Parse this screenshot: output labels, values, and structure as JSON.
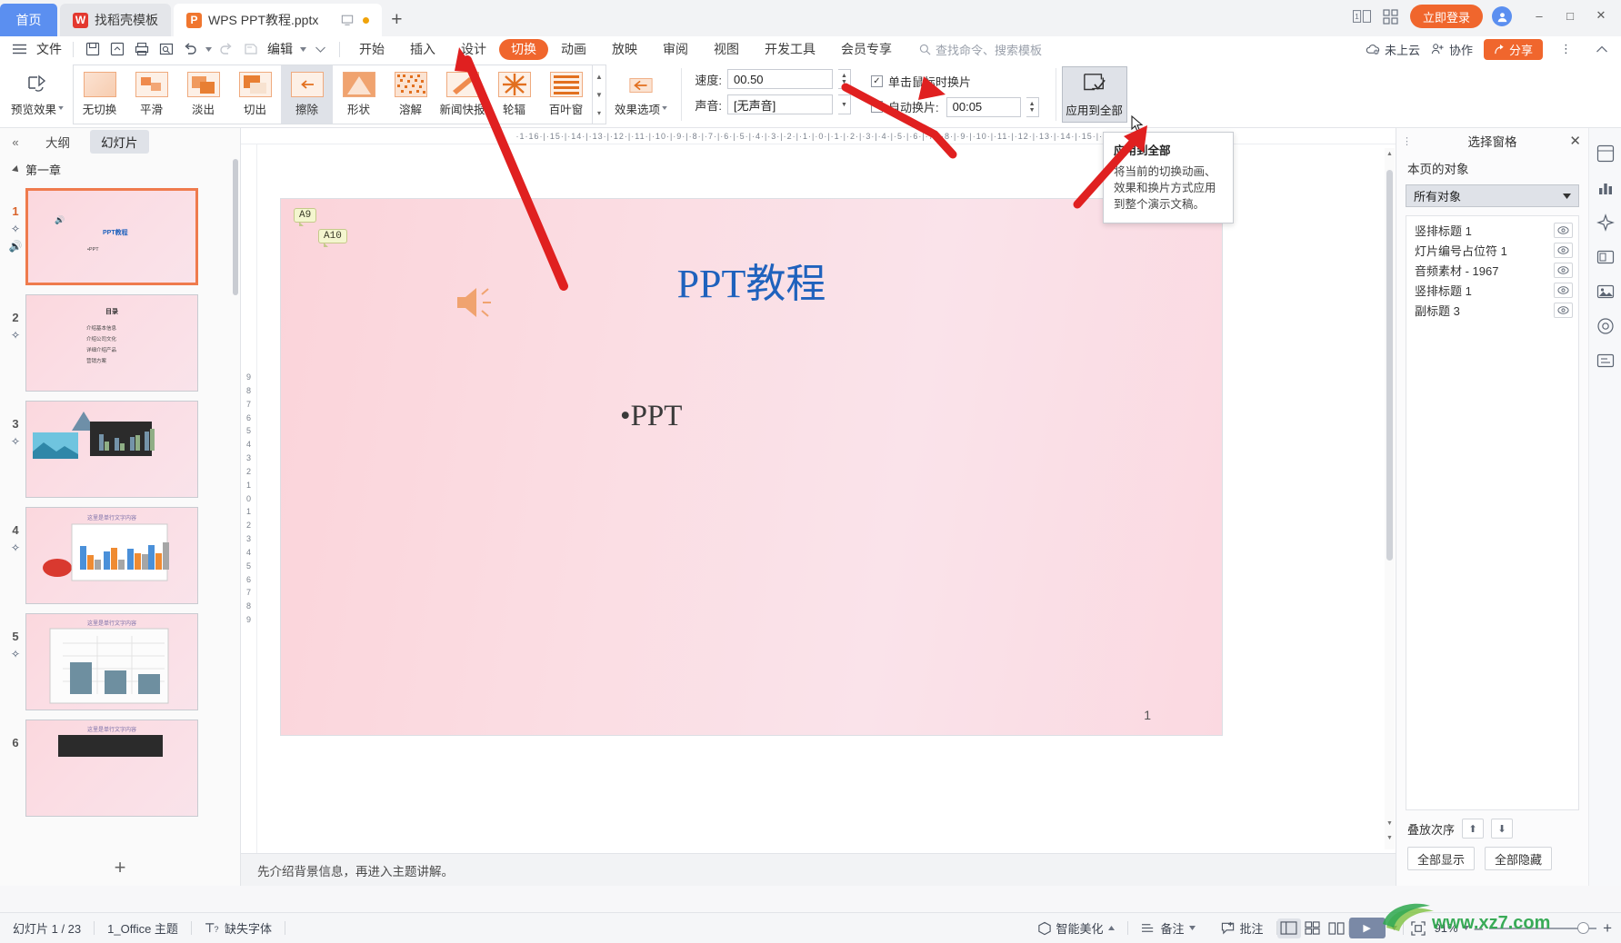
{
  "titlebar": {
    "home_tab": "首页",
    "tabs": [
      {
        "label": "找稻壳模板",
        "icon": "docer-icon",
        "active": false
      },
      {
        "label": "WPS PPT教程.pptx",
        "icon": "ppt-file-icon",
        "active": true
      }
    ],
    "new_tab": "+",
    "login_label": "立即登录",
    "window_buttons": [
      "minimize",
      "maximize",
      "close"
    ]
  },
  "menubar": {
    "file_label": "文件",
    "quick_icons": [
      "save-icon",
      "save-as-cloud-icon",
      "print-icon",
      "print-preview-icon",
      "undo-icon",
      "redo-icon",
      "format-painter-icon"
    ],
    "edit_label": "编辑",
    "ribbon_tabs": [
      {
        "label": "开始",
        "selected": false
      },
      {
        "label": "插入",
        "selected": false
      },
      {
        "label": "设计",
        "selected": false
      },
      {
        "label": "切换",
        "selected": true
      },
      {
        "label": "动画",
        "selected": false
      },
      {
        "label": "放映",
        "selected": false
      },
      {
        "label": "审阅",
        "selected": false
      },
      {
        "label": "视图",
        "selected": false
      },
      {
        "label": "开发工具",
        "selected": false
      },
      {
        "label": "会员专享",
        "selected": false
      }
    ],
    "search_placeholder": "查找命令、搜索模板",
    "cloud_status": "未上云",
    "collaborate": "协作",
    "share": "分享"
  },
  "ribbon": {
    "preview_label": "预览效果",
    "gallery": [
      {
        "label": "无切换",
        "selected": false
      },
      {
        "label": "平滑",
        "selected": false
      },
      {
        "label": "淡出",
        "selected": false
      },
      {
        "label": "切出",
        "selected": false
      },
      {
        "label": "擦除",
        "selected": true
      },
      {
        "label": "形状",
        "selected": false
      },
      {
        "label": "溶解",
        "selected": false
      },
      {
        "label": "新闻快报",
        "selected": false
      },
      {
        "label": "轮辐",
        "selected": false
      },
      {
        "label": "百叶窗",
        "selected": false
      }
    ],
    "effect_options_label": "效果选项",
    "speed_label": "速度:",
    "speed_value": "00.50",
    "sound_label": "声音:",
    "sound_value": "[无声音]",
    "click_advance_label": "单击鼠标时换片",
    "click_advance_checked": true,
    "auto_advance_label": "自动换片:",
    "auto_advance_checked": false,
    "auto_advance_value": "00:05",
    "apply_all_label": "应用到全部"
  },
  "tooltip": {
    "title": "应用到全部",
    "body": "将当前的切换动画、效果和换片方式应用到整个演示文稿。"
  },
  "left_pane": {
    "tab_outline": "大纲",
    "tab_slides": "幻灯片",
    "tab_selected": "幻灯片",
    "chapter_label": "第一章",
    "add_slide_label": "+",
    "slides": [
      {
        "num": "1",
        "selected": true,
        "kind": "title",
        "title": "PPT教程",
        "bullet": "PPT",
        "has_audio": true
      },
      {
        "num": "2",
        "selected": false,
        "kind": "toc",
        "title": "目录",
        "items": [
          "介绍基本信息",
          "介绍公司文化",
          "详细介绍产品",
          "营销方案"
        ]
      },
      {
        "num": "3",
        "selected": false,
        "kind": "mixed",
        "title": ""
      },
      {
        "num": "4",
        "selected": false,
        "kind": "chart",
        "title": "这里是单行文字内容"
      },
      {
        "num": "5",
        "selected": false,
        "kind": "chart2",
        "title": "这里是单行文字内容"
      },
      {
        "num": "6",
        "selected": false,
        "kind": "chart3",
        "title": "这里是单行文字内容"
      }
    ]
  },
  "editor": {
    "ruler_h": "·1·16·|·15·|·14·|·13·|·12·|·11·|·10·|·9·|·8·|·7·|·6·|·5·|·4·|·3·|·2·|·1·|·0·|·1·|·2·|·3·|·4·|·5·|·6·|·7·|·8·|·9·|·10·|·11·|·12·|·13·|·14·|·15·|·16·|",
    "ruler_v": [
      "9",
      "8",
      "7",
      "6",
      "5",
      "4",
      "3",
      "2",
      "1",
      "0",
      "1",
      "2",
      "3",
      "4",
      "5",
      "6",
      "7",
      "8",
      "9"
    ],
    "slide": {
      "title": "PPT教程",
      "bullet": "PPT",
      "page_number": "1",
      "anim_tags": [
        "A9",
        "A10"
      ],
      "audio_icon": "speaker-icon",
      "background_color": "#fbd9e1"
    },
    "notes_text": "先介绍背景信息，再进入主题讲解。"
  },
  "right_pane": {
    "title": "选择窗格",
    "section_label": "本页的对象",
    "filter_value": "所有对象",
    "objects": [
      {
        "label": "竖排标题 1"
      },
      {
        "label": "灯片编号占位符 1"
      },
      {
        "label": "音频素材 - 1967"
      },
      {
        "label": "竖排标题 1"
      },
      {
        "label": "副标题 3"
      }
    ],
    "order_label": "叠放次序",
    "show_all": "全部显示",
    "hide_all": "全部隐藏"
  },
  "rail_icons": [
    "feature-board-icon",
    "chart-tool-icon",
    "beautify-icon",
    "design-icon",
    "image-icon",
    "resource-icon",
    "textbox-icon"
  ],
  "statusbar": {
    "slide_count": "幻灯片 1 / 23",
    "theme": "1_Office 主题",
    "missing_font": "缺失字体",
    "smart_beautify": "智能美化",
    "notes": "备注",
    "comment": "批注",
    "views": [
      "normal-view-icon",
      "slide-sorter-icon",
      "reading-view-icon"
    ],
    "play_label": "▶",
    "zoom_level": "91%",
    "fit_icon": "fit-to-window-icon"
  },
  "watermark": {
    "text": "www.xz7.com",
    "color": "#2fa84f"
  },
  "colors": {
    "accent": "#f0662d",
    "home_tab": "#5b8ff0",
    "slide_title": "#1f62bd",
    "annotation_arrow": "#e02020"
  }
}
